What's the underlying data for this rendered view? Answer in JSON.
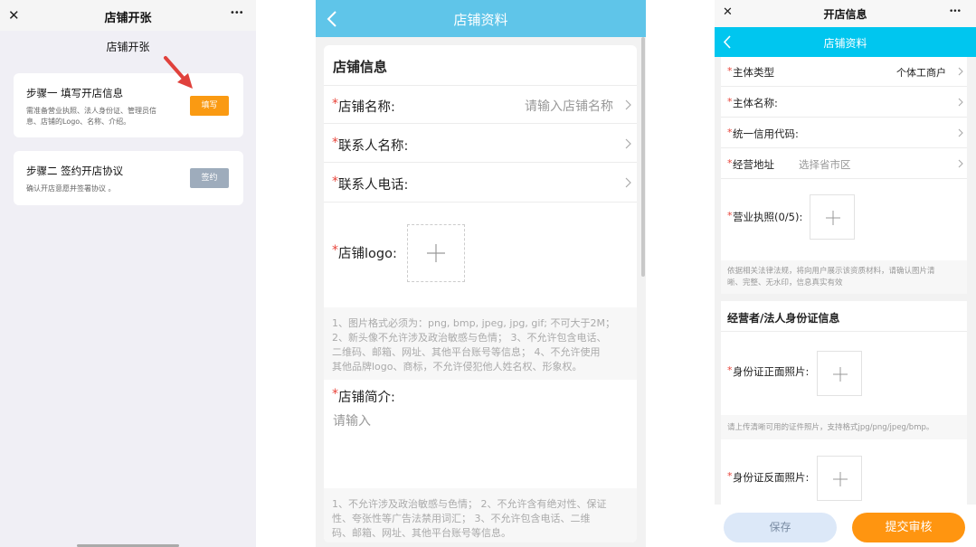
{
  "panel1": {
    "title": "店铺开张",
    "close_glyph": "✕",
    "more_glyph": "•••",
    "heading": "店铺开张",
    "step1": {
      "title": "步骤一 填写开店信息",
      "desc_line1": "需准备营业执照、法人身份证、管理员信",
      "desc_line2": "息、店铺的Logo、名称、介绍。",
      "button": "填写"
    },
    "step2": {
      "title": "步骤二 签约开店协议",
      "desc": "确认开店意愿并签署协议 。",
      "button": "签约"
    },
    "colors": {
      "bg": "#f0eff5",
      "fill_button": "#fa9a12",
      "sign_button": "#9eacbc",
      "arrow": "#e0413c"
    }
  },
  "panel2": {
    "title": "店铺资料",
    "section_title": "店铺信息",
    "required_mark": "*",
    "shop_name": {
      "label": "店铺名称:",
      "placeholder": "请输入店铺名称"
    },
    "contact_name": {
      "label": "联系人名称:"
    },
    "contact_phone": {
      "label": "联系人电话:"
    },
    "logo": {
      "label": "店铺logo:"
    },
    "logo_notes": [
      "1、图片格式必须为：png, bmp, jpeg, jpg, gif; 不可大于2M；",
      "2、新头像不允许涉及政治敏感与色情； 3、不允许包含电话、",
      "二维码、邮箱、网址、其他平台账号等信息； 4、不允许使用",
      "其他品牌logo、商标，不允许侵犯他人姓名权、形象权。"
    ],
    "intro": {
      "label": "店铺简介:",
      "placeholder": "请输入"
    },
    "intro_notes": [
      "1、不允许涉及政治敏感与色情； 2、不允许含有绝对性、保证",
      "性、夸张性等广告法禁用词汇； 3、不允许包含电话、二维",
      "码、邮箱、网址、其他平台账号等信息。"
    ],
    "colors": {
      "header": "#5fc5e9",
      "bg": "#f2f2f2"
    }
  },
  "panel3": {
    "top_title": "开店信息",
    "close_glyph": "✕",
    "more_glyph": "•••",
    "subtitle": "店铺资料",
    "entity_type": {
      "label": "主体类型",
      "value": "个体工商户"
    },
    "entity_name": {
      "label": "主体名称:"
    },
    "credit_code": {
      "label": "统一信用代码:"
    },
    "address": {
      "label": "经营地址",
      "placeholder": "选择省市区"
    },
    "license": {
      "label": "营业执照(0/5):"
    },
    "license_note_line1": "依据相关法律法规，将向用户展示该资质材料，请确认图片清",
    "license_note_line2": "晰、完整、无水印，信息真实有效",
    "id_section_title": "经营者/法人身份证信息",
    "id_front": {
      "label": "身份证正面照片:"
    },
    "id_note": "请上传清晰可用的证件照片，支持格式jpg/png/jpeg/bmp。",
    "id_back": {
      "label": "身份证反面照片:"
    },
    "save_button": "保存",
    "submit_button": "提交审核",
    "colors": {
      "header": "#00c6ef",
      "save": "#dce8f8",
      "submit": "#ff9510"
    }
  }
}
